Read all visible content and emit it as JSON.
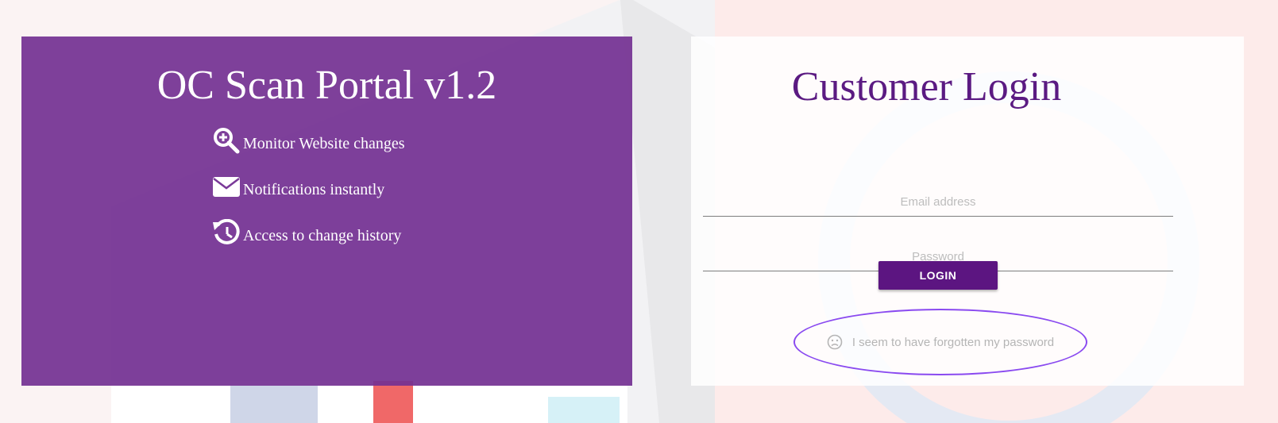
{
  "brand": {
    "title": "OC Scan Portal v1.2",
    "color": "#743292"
  },
  "features": [
    {
      "icon": "zoom-in-icon",
      "label": "Monitor Website changes"
    },
    {
      "icon": "envelope-icon",
      "label": "Notifications instantly"
    },
    {
      "icon": "history-icon",
      "label": "Access to change history"
    }
  ],
  "login": {
    "title": "Customer Login",
    "title_color": "#5b1a82",
    "email_placeholder": "Email address",
    "email_value": "",
    "password_placeholder": "Password",
    "password_value": "",
    "button_label": "LOGIN",
    "button_color": "#5c1581",
    "forgot_icon": "sad-face-icon",
    "forgot_label": "I seem to have forgotten my password",
    "highlight_color": "#8a4af0"
  }
}
